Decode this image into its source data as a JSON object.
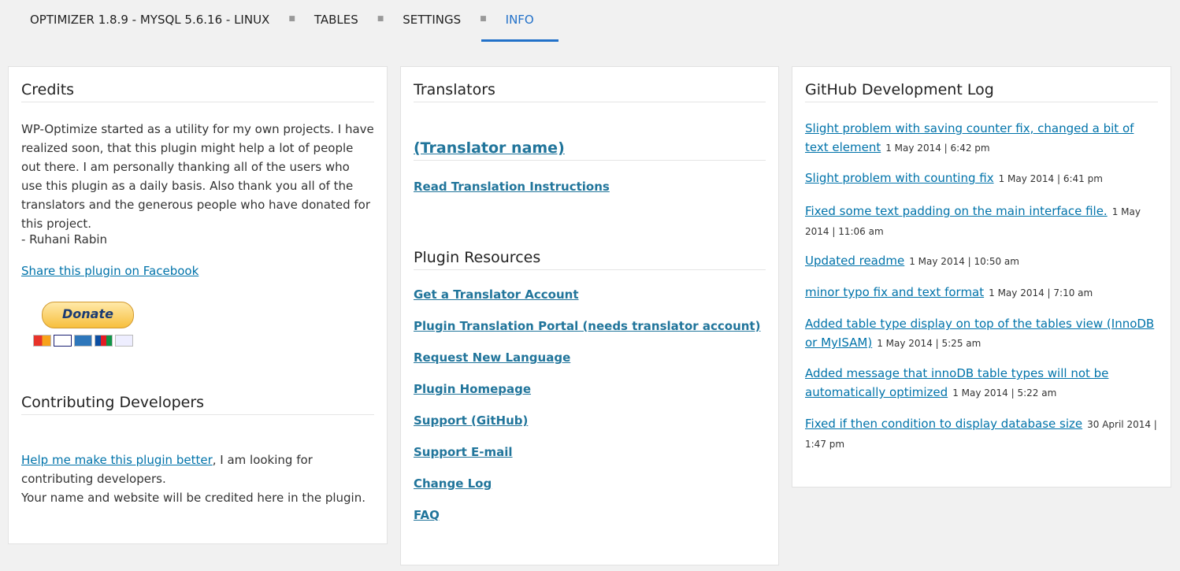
{
  "nav": {
    "items": [
      "OPTIMIZER 1.8.9 - MYSQL 5.6.16 - LINUX",
      "TABLES",
      "SETTINGS",
      "INFO"
    ],
    "active": "INFO",
    "separator": "■"
  },
  "credits": {
    "title": "Credits",
    "text": "WP-Optimize started as a utility for my own projects. I have realized soon, that this plugin might help a lot of people out there. I am personally thanking all of the users who use this plugin as a daily basis. Also thank you all of the translators and the generous people who have donated for this project.",
    "author": "- Ruhani Rabin",
    "share_link": "Share this plugin on Facebook",
    "donate_label": "Donate",
    "card_icons": [
      "mastercard-icon",
      "visa-icon",
      "amex-icon",
      "jcb-icon",
      "bank-icon"
    ]
  },
  "contrib": {
    "title": "Contributing Developers",
    "help_link": "Help me make this plugin better",
    "help_rest": ", I am looking for contributing developers.",
    "line2": "Your name and website will be credited here in the plugin."
  },
  "translators": {
    "title": "Translators",
    "translator_name": "(Translator name)",
    "instructions_link": "Read Translation Instructions"
  },
  "resources": {
    "title": "Plugin Resources",
    "links": [
      "Get a Translator Account",
      "Plugin Translation Portal (needs translator account)",
      "Request New Language",
      "Plugin Homepage",
      "Support (GitHub)",
      "Support E-mail",
      "Change Log",
      "FAQ"
    ]
  },
  "github": {
    "title": "GitHub Development Log",
    "entries": [
      {
        "text": "Slight problem with saving counter fix, changed a bit of text element",
        "meta": "1 May 2014 | 6:42 pm"
      },
      {
        "text": "Slight problem with counting fix",
        "meta": "1 May 2014 | 6:41 pm"
      },
      {
        "text": "Fixed some text padding on the main interface file.",
        "meta": "1 May 2014 | 11:06 am"
      },
      {
        "text": "Updated readme",
        "meta": "1 May 2014 | 10:50 am"
      },
      {
        "text": "minor typo fix and text format",
        "meta": "1 May 2014 | 7:10 am"
      },
      {
        "text": "Added table type display on top of the tables view (InnoDB or MyISAM)",
        "meta": "1 May 2014 | 5:25 am"
      },
      {
        "text": "Added message that innoDB table types will not be automatically optimized",
        "meta": "1 May 2014 | 5:22 am"
      },
      {
        "text": "Fixed if then condition to display database size",
        "meta": "30 April 2014 | 1:47 pm"
      }
    ]
  },
  "colors": {
    "accent": "#2271c9",
    "link": "#0073aa",
    "background": "#f1f1f1"
  }
}
